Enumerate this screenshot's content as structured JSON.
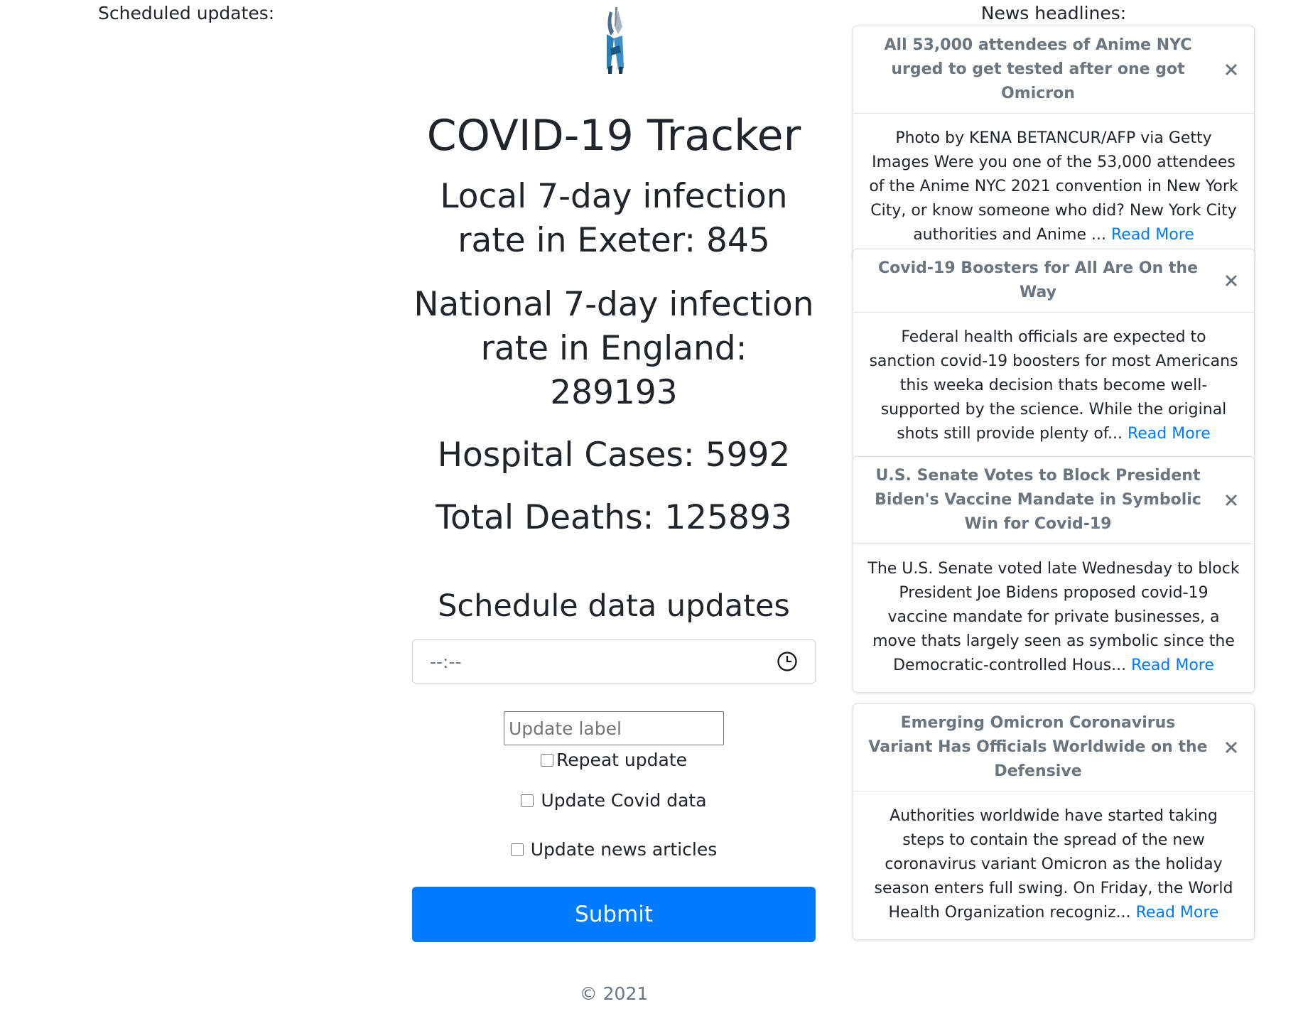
{
  "sidebar": {
    "scheduled_label": "Scheduled updates:"
  },
  "header": {
    "title": "COVID-19 Tracker"
  },
  "stats": {
    "local": "Local 7-day infection rate in Exeter: 845",
    "national": "National 7-day infection rate in England: 289193",
    "hospital": "Hospital Cases: 5992",
    "deaths": "Total Deaths: 125893"
  },
  "schedule": {
    "title": "Schedule data updates",
    "time_value": "--:--",
    "label_placeholder": "Update label",
    "repeat_label": "Repeat update",
    "covid_label": "Update Covid data",
    "news_label": "Update news articles",
    "submit_label": "Submit"
  },
  "footer": {
    "text": "© 2021"
  },
  "news": {
    "heading": "News headlines:",
    "read_more_label": "Read More",
    "articles": [
      {
        "title": "All 53,000 attendees of Anime NYC urged to get tested after one got Omicron",
        "summary": "Photo by KENA BETANCUR/AFP via Getty Images Were you one of the 53,000 attendees of the Anime NYC 2021 convention in New York City, or know someone who did? New York City authorities and Anime ..."
      },
      {
        "title": "Covid-19 Boosters for All Are On the Way",
        "summary": "Federal health officials are expected to sanction covid-19 boosters for most Americans this weeka decision thats become well-supported by the science. While the original shots still provide plenty of..."
      },
      {
        "title": "U.S. Senate Votes to Block President Biden's Vaccine Mandate in Symbolic Win for Covid-19",
        "summary": "The U.S. Senate voted late Wednesday to block President Joe Bidens proposed covid-19 vaccine mandate for private businesses, a move thats largely seen as symbolic since the Democratic-controlled Hous..."
      },
      {
        "title": "Emerging Omicron Coronavirus Variant Has Officials Worldwide on the Defensive",
        "summary": "Authorities worldwide have started taking steps to contain the spread of the new coronavirus variant Omicron as the holiday season enters full swing. On Friday, the World Health Organization recogniz..."
      }
    ]
  },
  "colors": {
    "primary": "#007bff",
    "text": "#212529",
    "muted": "#6c757d",
    "border": "#dee2e6"
  },
  "icons": {
    "logo": "syringe-logo-icon",
    "clock": "clock-icon",
    "close": "close-icon"
  }
}
